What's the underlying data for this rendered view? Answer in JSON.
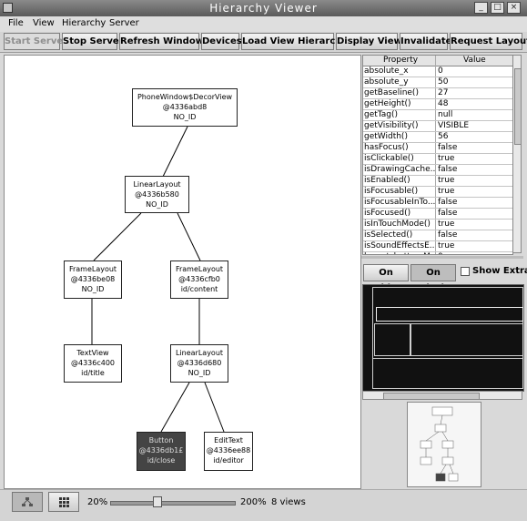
{
  "window": {
    "title": "Hierarchy Viewer"
  },
  "menu": [
    "File",
    "View",
    "Hierarchy",
    "Server"
  ],
  "toolbar": {
    "start_server": "Start Server",
    "stop_server": "Stop Server",
    "refresh_windows": "Refresh Windows",
    "devices": "Devices",
    "load_view_hierarchy": "Load View Hierarchy",
    "display_view": "Display View",
    "invalidate": "Invalidate",
    "request_layout": "Request Layout"
  },
  "tree": {
    "nodes": [
      {
        "id": "decor",
        "name": "PhoneWindow$DecorView",
        "address": "@4336abd8",
        "view_id": "NO_ID"
      },
      {
        "id": "linear1",
        "name": "LinearLayout",
        "address": "@4336b580",
        "view_id": "NO_ID"
      },
      {
        "id": "frame1",
        "name": "FrameLayout",
        "address": "@4336be08",
        "view_id": "NO_ID"
      },
      {
        "id": "frame2",
        "name": "FrameLayout",
        "address": "@4336cfb0",
        "view_id": "id/content"
      },
      {
        "id": "textview",
        "name": "TextView",
        "address": "@4336c400",
        "view_id": "id/title"
      },
      {
        "id": "linear2",
        "name": "LinearLayout",
        "address": "@4336d680",
        "view_id": "NO_ID"
      },
      {
        "id": "button",
        "name": "Button",
        "address": "@4336db1£",
        "view_id": "id/close",
        "selected": true
      },
      {
        "id": "edittext",
        "name": "EditText",
        "address": "@4336ee88",
        "view_id": "id/editor"
      }
    ],
    "edges": [
      [
        "decor",
        "linear1"
      ],
      [
        "linear1",
        "frame1"
      ],
      [
        "linear1",
        "frame2"
      ],
      [
        "frame1",
        "textview"
      ],
      [
        "frame2",
        "linear2"
      ],
      [
        "linear2",
        "button"
      ],
      [
        "linear2",
        "edittext"
      ]
    ]
  },
  "properties": {
    "header_property": "Property",
    "header_value": "Value",
    "rows": [
      {
        "name": "absolute_x",
        "value": "0"
      },
      {
        "name": "absolute_y",
        "value": "50"
      },
      {
        "name": "getBaseline()",
        "value": "27"
      },
      {
        "name": "getHeight()",
        "value": "48"
      },
      {
        "name": "getTag()",
        "value": "null"
      },
      {
        "name": "getVisibility()",
        "value": "VISIBLE"
      },
      {
        "name": "getWidth()",
        "value": "56"
      },
      {
        "name": "hasFocus()",
        "value": "false"
      },
      {
        "name": "isClickable()",
        "value": "true"
      },
      {
        "name": "isDrawingCache...",
        "value": "false"
      },
      {
        "name": "isEnabled()",
        "value": "true"
      },
      {
        "name": "isFocusable()",
        "value": "true"
      },
      {
        "name": "isFocusableInTo...",
        "value": "false"
      },
      {
        "name": "isFocused()",
        "value": "false"
      },
      {
        "name": "isInTouchMode()",
        "value": "true"
      },
      {
        "name": "isSelected()",
        "value": "false"
      },
      {
        "name": "isSoundEffectsE...",
        "value": "true"
      },
      {
        "name": "layout_bottomM...",
        "value": "0"
      }
    ]
  },
  "display_options": {
    "on_white": "On White",
    "on_black": "On Black",
    "show_extras": "Show Extras"
  },
  "status": {
    "zoom_min": "20%",
    "zoom_max": "200%",
    "zoom_level_percent": 37,
    "view_count": "8 views"
  },
  "colors": {
    "titlebar": "#6e6e6e",
    "selected_node": "#444444",
    "canvas": "#ffffff",
    "preview_bg": "#111111"
  }
}
